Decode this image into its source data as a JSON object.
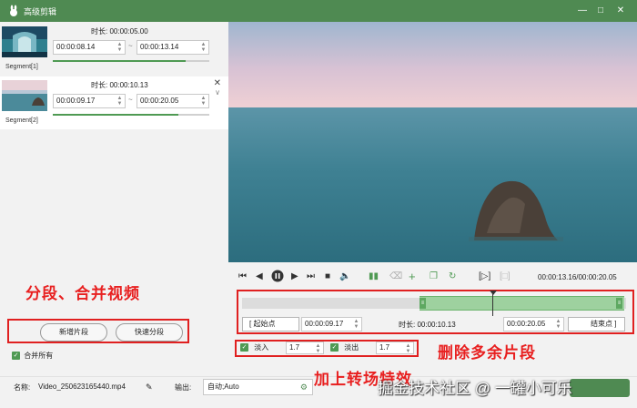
{
  "window": {
    "title": "高级剪辑",
    "logo_icon": "rabbit-logo-icon",
    "accent_color": "#4f8a52"
  },
  "segments": [
    {
      "name": "Segment[1]",
      "duration_label": "时长: 00:00:05.00",
      "start": "00:00:08.14",
      "end": "00:00:13.14",
      "progress": 0.85
    },
    {
      "name": "Segment[2]",
      "duration_label": "时长: 00:00:10.13",
      "start": "00:00:09.17",
      "end": "00:00:20.05",
      "progress": 0.8
    }
  ],
  "left_actions": {
    "add_segment": "新增片段",
    "quick_split": "快速分段",
    "merge_all": "合并所有"
  },
  "annotations": {
    "segment_merge": "分段、合并视频",
    "delete_extra": "删除多余片段",
    "add_transition": "加上转场特效"
  },
  "playback": {
    "time_readout": "00:00:13.16/00:00:20.05"
  },
  "range": {
    "start_btn": "[ 起始点",
    "start_value": "00:00:09.17",
    "duration_label": "时长: 00:00:10.13",
    "end_value": "00:00:20.05",
    "end_btn": "结束点 ]"
  },
  "fade": {
    "in_label": "淡入",
    "in_value": "1.7",
    "out_label": "淡出",
    "out_value": "1.7"
  },
  "output": {
    "name_label": "名称:",
    "filename": "Video_250623165440.mp4",
    "output_label": "输出:",
    "output_value": "自动;Auto"
  },
  "watermark": "掘金技术社区 @ 一罐小可乐"
}
